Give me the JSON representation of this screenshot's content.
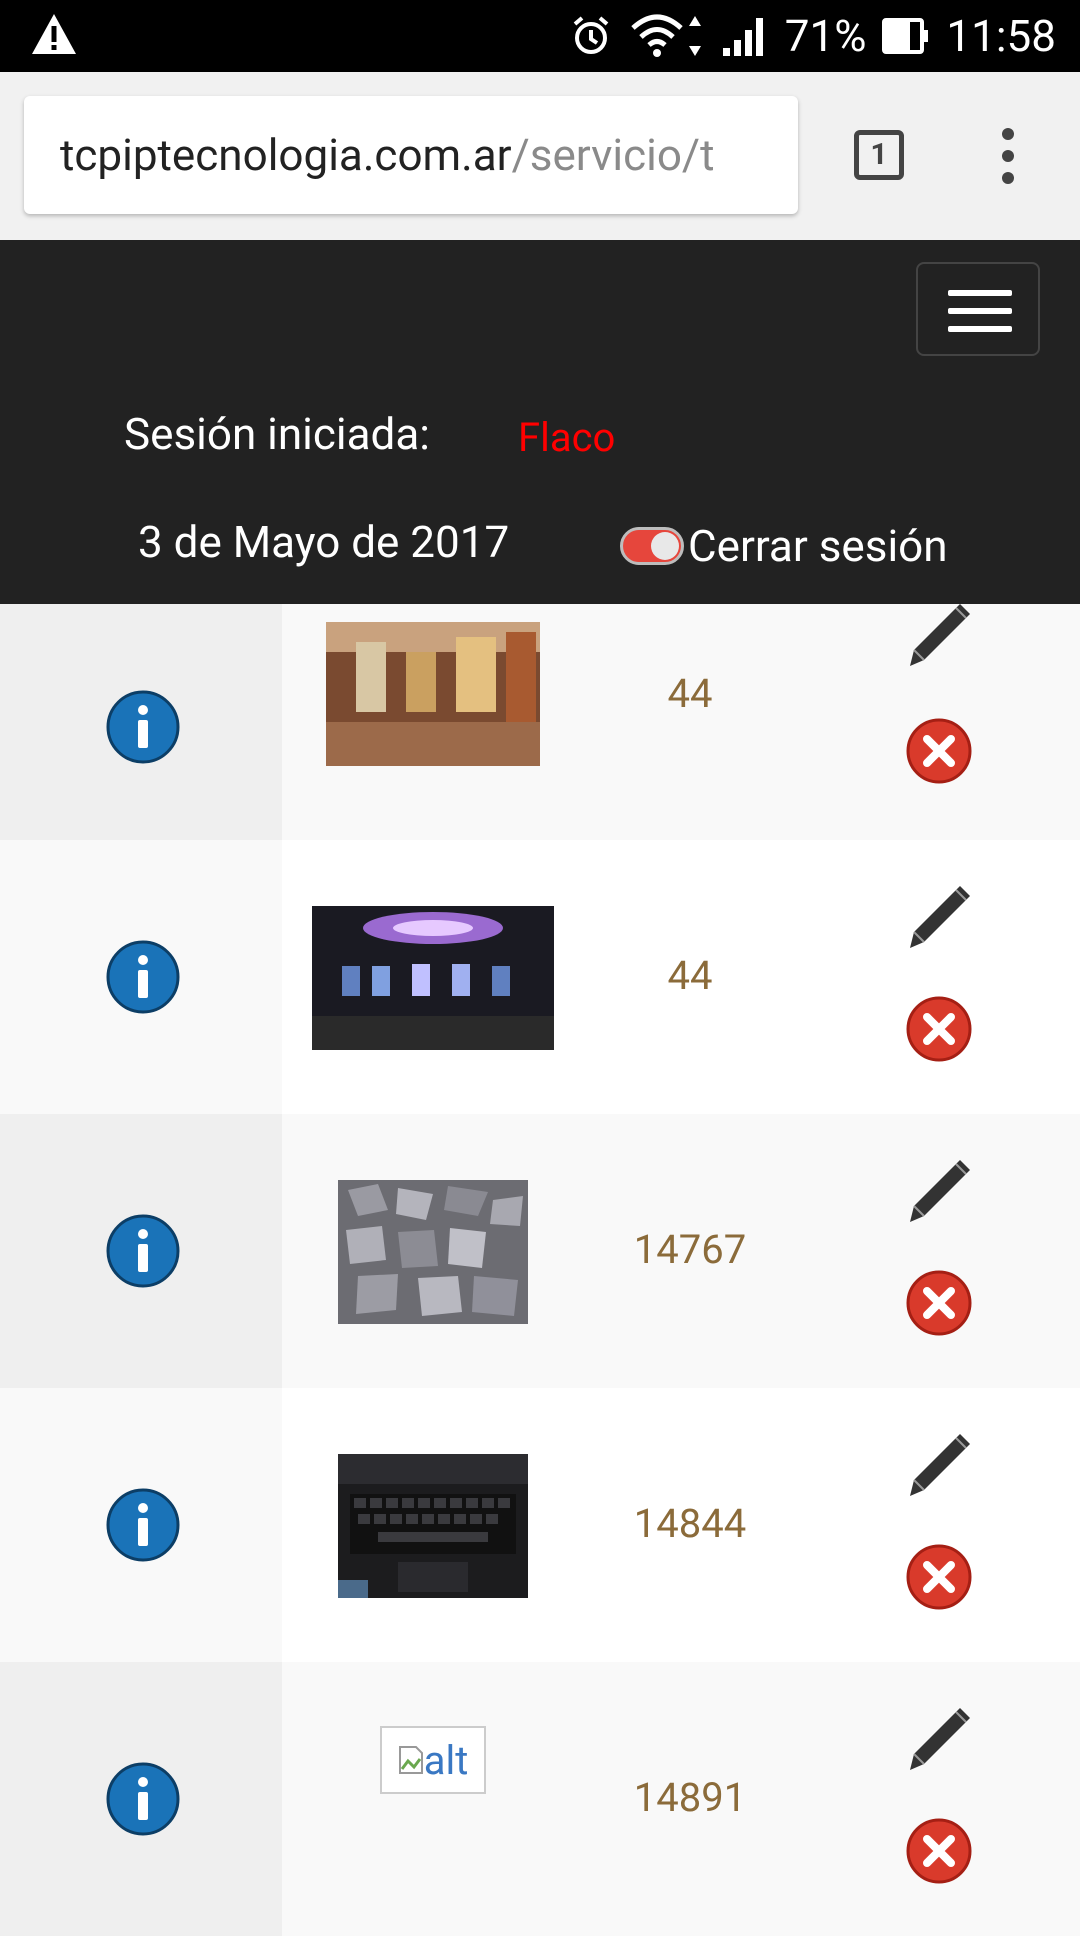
{
  "status_bar": {
    "battery": "71%",
    "time": "11:58"
  },
  "browser": {
    "url_host": "tcpiptecnologia.com.ar",
    "url_path": "/servicio/t",
    "tab_count": "1"
  },
  "header": {
    "session_label": "Sesión iniciada:",
    "session_user": "Flaco",
    "date": "3 de Mayo de 2017",
    "logout_label": "Cerrar sesión"
  },
  "rows": [
    {
      "qty": "44",
      "image": "jewelry-store-photo"
    },
    {
      "qty": "44",
      "image": "casino-photo"
    },
    {
      "qty": "14767",
      "image": "gravel-photo"
    },
    {
      "qty": "14844",
      "image": "laptop-keyboard-photo"
    },
    {
      "qty": "14891",
      "image": "broken-image",
      "alt": "alt"
    }
  ],
  "colors": {
    "user": "#ff0000",
    "qty": "#8b6b3a",
    "navbar": "#222222"
  }
}
